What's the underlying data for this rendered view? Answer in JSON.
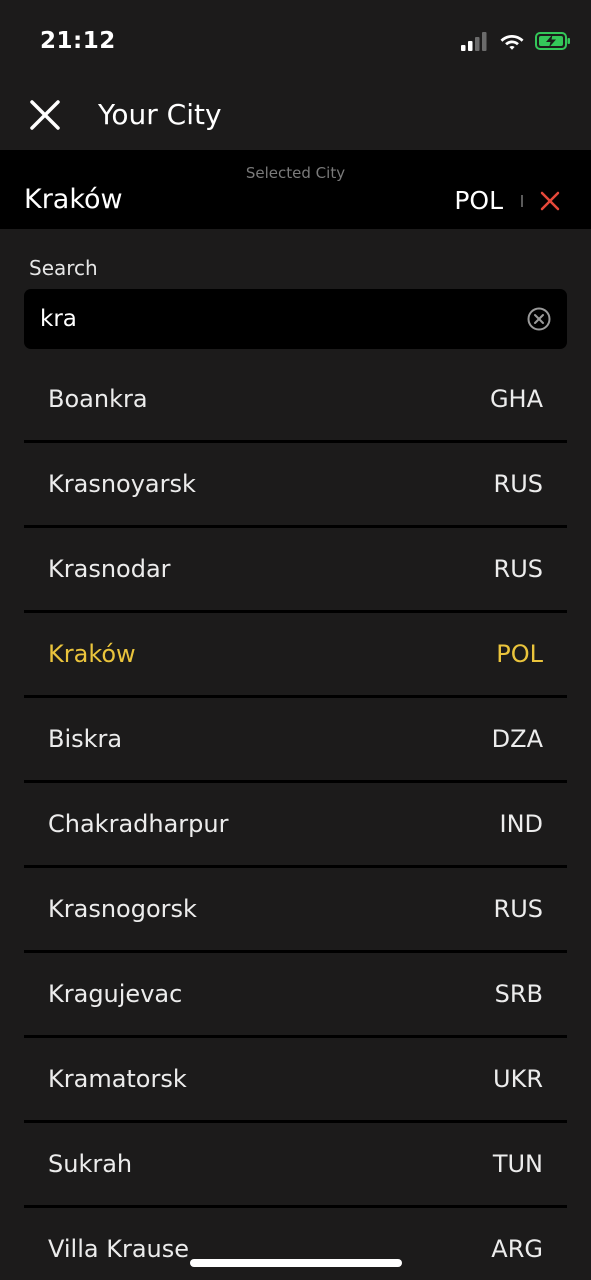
{
  "status_bar": {
    "time": "21:12",
    "icons": [
      "cellular-signal-icon",
      "wifi-icon",
      "battery-charging-icon"
    ],
    "battery_color": "#34c759"
  },
  "header": {
    "title": "Your City",
    "close_icon": "close-icon"
  },
  "selected_city": {
    "caption": "Selected City",
    "city": "Kraków",
    "country": "POL",
    "remove_icon": "close-icon",
    "remove_color": "#e5483a"
  },
  "search": {
    "label": "Search",
    "value": "kra",
    "clear_icon": "clear-circle-icon"
  },
  "accent_color": "#eac43c",
  "results": [
    {
      "city": "Boankra",
      "country": "GHA",
      "selected": false
    },
    {
      "city": "Krasnoyarsk",
      "country": "RUS",
      "selected": false
    },
    {
      "city": "Krasnodar",
      "country": "RUS",
      "selected": false
    },
    {
      "city": "Kraków",
      "country": "POL",
      "selected": true
    },
    {
      "city": "Biskra",
      "country": "DZA",
      "selected": false
    },
    {
      "city": "Chakradharpur",
      "country": "IND",
      "selected": false
    },
    {
      "city": "Krasnogorsk",
      "country": "RUS",
      "selected": false
    },
    {
      "city": "Kragujevac",
      "country": "SRB",
      "selected": false
    },
    {
      "city": "Kramatorsk",
      "country": "UKR",
      "selected": false
    },
    {
      "city": "Sukrah",
      "country": "TUN",
      "selected": false
    },
    {
      "city": "Villa Krause",
      "country": "ARG",
      "selected": false
    }
  ]
}
